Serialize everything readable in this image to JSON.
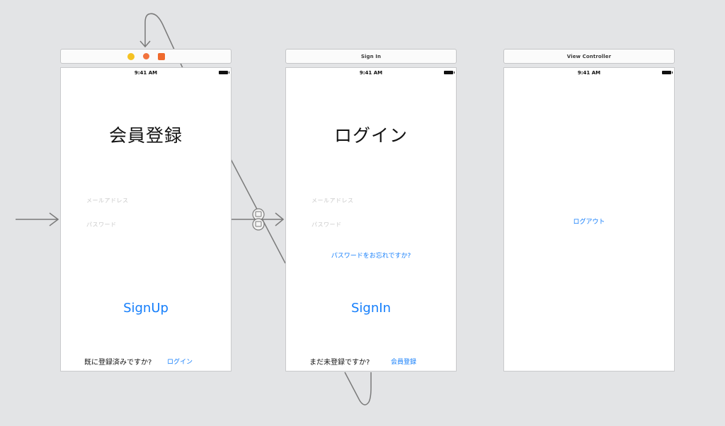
{
  "scenes": {
    "signup": {
      "status_time": "9:41 AM",
      "heading": "会員登録",
      "email_placeholder": "メールアドレス",
      "password_placeholder": "パスワード",
      "primary_button": "SignUp",
      "footer_text": "既に登録済みですか?",
      "footer_link": "ログイン"
    },
    "signin": {
      "bar_title": "Sign In",
      "status_time": "9:41 AM",
      "heading": "ログイン",
      "email_placeholder": "メールアドレス",
      "password_placeholder": "パスワード",
      "forgot_link": "パスワードをお忘れですか?",
      "primary_button": "SignIn",
      "footer_text": "まだ未登録ですか?",
      "footer_link": "会員登録"
    },
    "view_controller": {
      "bar_title": "View Controller",
      "status_time": "9:41 AM",
      "logout_link": "ログアウト"
    }
  },
  "colors": {
    "canvas_background": "#e3e4e6",
    "link_blue": "#147efb",
    "placeholder_gray": "#c9c9c9",
    "segue_line": "#7a7a7a"
  },
  "icons": {
    "scene_dock": [
      "view-controller-icon",
      "first-responder-icon",
      "exit-icon"
    ],
    "segue": "segue-icon",
    "entry_point": "entry-arrow-icon"
  }
}
